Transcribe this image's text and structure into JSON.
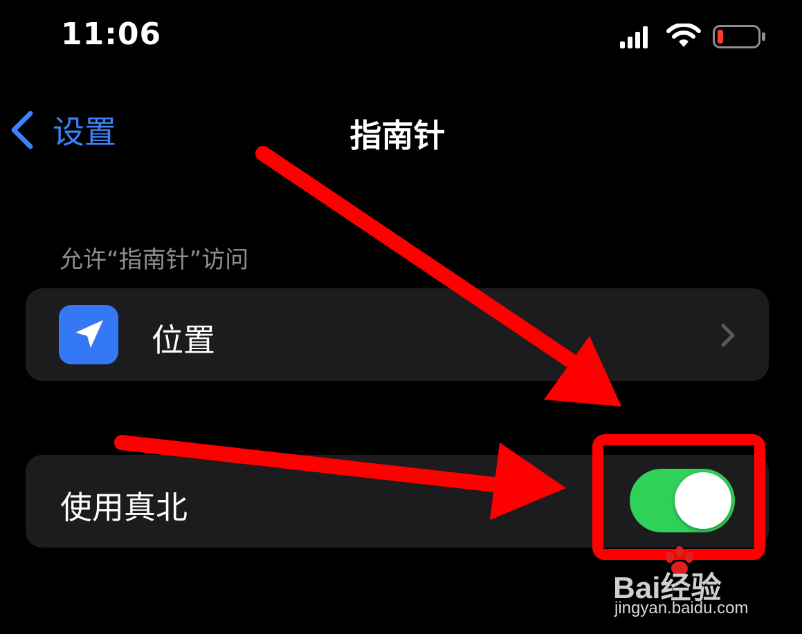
{
  "status_bar": {
    "time": "11:06",
    "icons": [
      "cellular-signal-icon",
      "wifi-icon",
      "battery-low-icon"
    ]
  },
  "nav": {
    "back_label": "设置",
    "title": "指南针"
  },
  "section": {
    "header": "允许“指南针”访问"
  },
  "location_cell": {
    "label": "位置",
    "icon": "location-arrow-icon"
  },
  "true_north": {
    "label": "使用真北",
    "toggle_on": true
  },
  "watermark": {
    "logo": "Bai经验",
    "url": "jingyan.baidu.com"
  },
  "colors": {
    "accent": "#3a82f7",
    "toggle_on": "#30d158",
    "annotation": "#ff0000",
    "cell_bg": "#1c1c1e"
  }
}
